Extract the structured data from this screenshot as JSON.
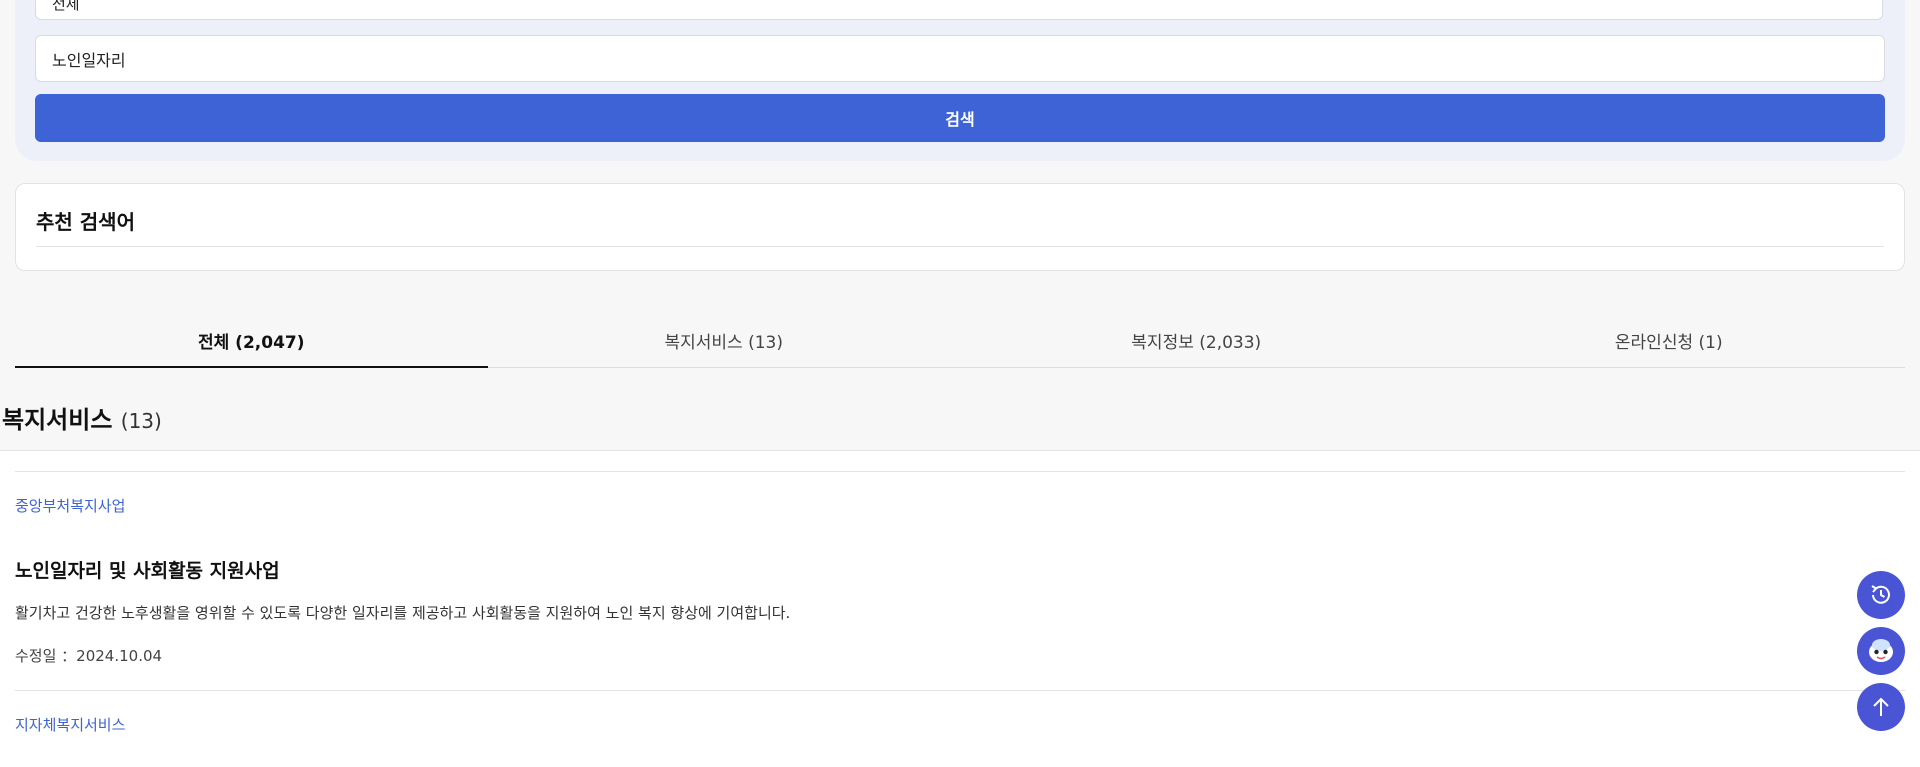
{
  "search": {
    "select_value": "전체",
    "keyword_value": "노인일자리",
    "button_label": "검색"
  },
  "recommend": {
    "title": "추천 검색어"
  },
  "tabs": [
    {
      "label": "전체  (2,047)",
      "active": true
    },
    {
      "label": "복지서비스 (13)",
      "active": false
    },
    {
      "label": "복지정보 (2,033)",
      "active": false
    },
    {
      "label": "온라인신청 (1)",
      "active": false
    }
  ],
  "section": {
    "title": "복지서비스",
    "count": "(13)"
  },
  "items": [
    {
      "category": "중앙부처복지사업",
      "title": "노인일자리 및 사회활동 지원사업",
      "description": "활기차고 건강한 노후생활을 영위할 수 있도록 다양한 일자리를 제공하고 사회활동을 지원하여 노인 복지 향상에 기여합니다.",
      "date_label": "수정일 ：2024.10.04"
    },
    {
      "category": "지자체복지서비스"
    }
  ],
  "floating": {
    "history_icon": "history-icon",
    "chatbot_icon": "chatbot-icon",
    "top_icon": "arrow-up-icon"
  },
  "colors": {
    "accent": "#3d63d6",
    "floating": "#4a55d6",
    "link": "#3d63d6"
  }
}
